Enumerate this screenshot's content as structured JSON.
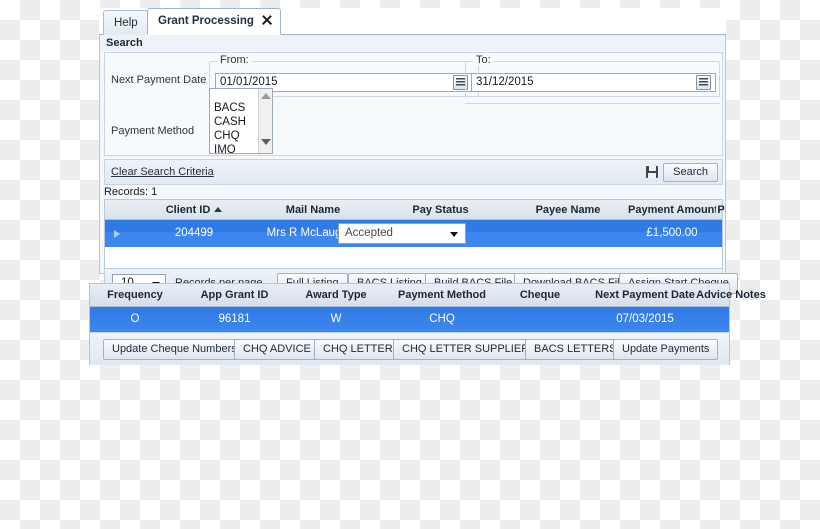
{
  "tabs": [
    {
      "label": "Help",
      "active": false
    },
    {
      "label": "Grant Processing",
      "active": true,
      "closable": true
    }
  ],
  "search_panel": {
    "title": "Search",
    "next_payment_date": {
      "label": "Next Payment Date",
      "from_label": "From:",
      "from_value": "01/01/2015",
      "to_label": "To:",
      "to_value": "31/12/2015",
      "calendar_icon": "calendar-icon"
    },
    "payment_method": {
      "label": "Payment Method",
      "options": [
        "BACS",
        "CASH",
        "CHQ",
        "IMO"
      ],
      "scroll_up_icon": "chevron-up-icon",
      "scroll_down_icon": "chevron-down-icon"
    },
    "clear_link": "Clear Search Criteria",
    "save_icon": "save-icon",
    "open_icon": "open-folder-icon",
    "search_button": "Search"
  },
  "results": {
    "records_label": "Records:",
    "records_count": "1",
    "columns": [
      "Client ID",
      "Mail Name",
      "Pay  Status",
      "Payee Name",
      "Payment Amount",
      "P"
    ],
    "sort_column": "Client ID",
    "sort_icon": "sort-ascending-icon",
    "row": {
      "expander_icon": "expand-row-icon",
      "client_id": "204499",
      "mail_name": "Mrs R McLaughlin",
      "pay_status": "Accepted",
      "payee_name": "",
      "payment_amount": "£1,500.00",
      "extra": ""
    }
  },
  "pager": {
    "page_size": "10",
    "page_size_label": "Records per page",
    "buttons": [
      "Full Listing",
      "BACS Listing",
      "Build BACS File",
      "Download BACS File",
      "Assign Start Cheque"
    ]
  },
  "detail": {
    "columns": [
      "Frequency",
      "App Grant ID",
      "Award Type",
      "Payment Method",
      "Cheque",
      "Next Payment Date",
      "Advice Notes"
    ],
    "row": {
      "frequency": "O",
      "app_grant_id": "96181",
      "award_type": "W",
      "payment_method": "CHQ",
      "cheque": "",
      "next_payment_date": "07/03/2015",
      "advice_notes": ""
    },
    "buttons": [
      "Update Cheque Numbers",
      "CHQ ADVICE",
      "CHQ LETTER",
      "CHQ LETTER SUPPLIER",
      "BACS LETTERS",
      "Update Payments"
    ]
  },
  "colors": {
    "selection_blue": "#2f7ae5",
    "panel_bg": "#f4f7fb",
    "header_grad_top": "#eaeff5",
    "header_grad_bottom": "#d8e1eb",
    "border": "#b6c6d8"
  }
}
